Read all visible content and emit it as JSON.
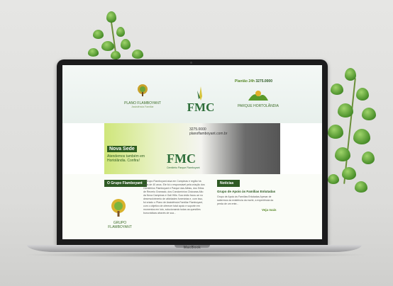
{
  "device": {
    "brand": "MacBook"
  },
  "site": {
    "phone_label": "Plantão 24h",
    "phone_number": "3275.0000",
    "logos": {
      "plano": {
        "name": "PLANO FLAMBOYANT",
        "tagline": "Assistência Familiar"
      },
      "fmc": {
        "name": "FMC"
      },
      "parque": {
        "name": "PARQUE HORTOLÂNDIA"
      }
    },
    "banner": {
      "title": "Nova Sede",
      "subtitle": "Atendemos também em Hortolândia. Confira!",
      "wall_number": "3275.0000",
      "wall_url": "planoflamboyant.com.br",
      "fmc_caption": "Cemitério Parque Flamboyant"
    },
    "about": {
      "heading": "O Grupo Flamboyant",
      "logo_text": "GRUPO FLAMBOYANT",
      "text": "O Grupo Flamboyant atua em Campinas e região há mais de 40 anos. Ele foi o responsável pela criação dos Cemitérios Flamboyant e Parque das Aléias, dos Sítios de Recreio Gramado, dos Condomínios Chácaras Alto da Nova Campinas e Gali Hills. Sua visão focou-se no desenvolvimento de atividades funerárias e, com isso, foi criado o Plano de Assistência Familiar Flamboyant, com o objetivo de oferecer total apoio e suporte em momentos em luto, solucionando todas as questões burocráticas através de sua..."
    },
    "news": {
      "heading": "Notícias",
      "item_title": "Grupo de Apoio às Famílias Enlutadas",
      "item_text": "Grupo de Apoio às Famílias Enlutadas Apesar de sabermos da existência da morte, a experiência da perda de um ente...",
      "more_label": "Veja mais"
    }
  }
}
